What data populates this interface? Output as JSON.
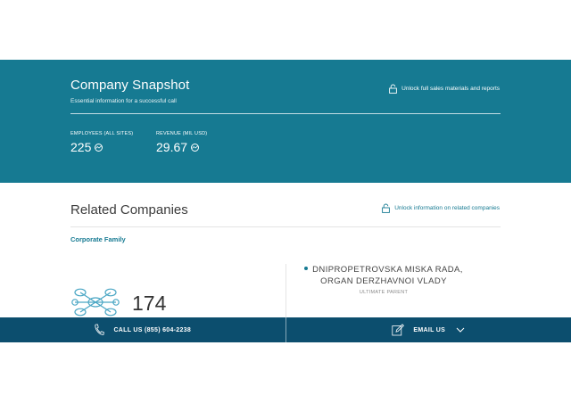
{
  "snapshot": {
    "title": "Company Snapshot",
    "subtitle": "Essential information for a successful call",
    "unlock_label": "Unlock full sales materials and reports",
    "metrics": [
      {
        "label": "EMPLOYEES (ALL SITES)",
        "value": "225"
      },
      {
        "label": "REVENUE (MIL USD)",
        "value": "29.67"
      }
    ]
  },
  "related": {
    "title": "Related Companies",
    "unlock_label": "Unlock information on related companies",
    "corporate_family_label": "Corporate Family",
    "family_count": "174",
    "parent_name": "DNIPROPETROVSKA MISKA RADA, ORGAN DERZHAVNOI VLADY",
    "parent_label": "ULTIMATE PARENT"
  },
  "contact": {
    "call_label": "CALL US (855) 604-2238",
    "email_label": "EMAIL US"
  },
  "colors": {
    "accent": "#167a92",
    "footer": "#0c4e6e"
  },
  "icons": [
    "lock-icon",
    "trend-icon",
    "network-icon",
    "phone-icon",
    "edit-icon",
    "chevron-down-icon"
  ]
}
